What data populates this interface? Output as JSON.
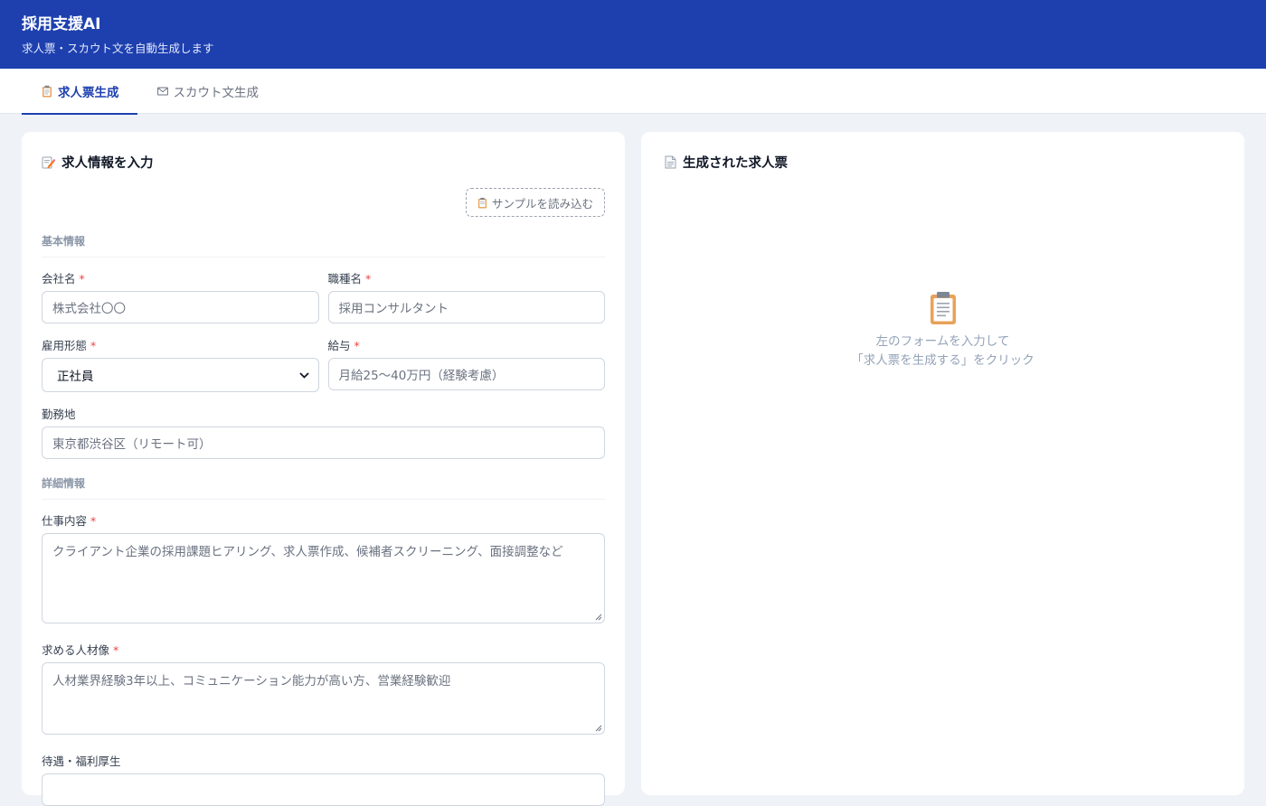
{
  "app": {
    "title": "採用支援AI",
    "subtitle": "求人票・スカウト文を自動生成します"
  },
  "tabs": [
    {
      "label": "求人票生成",
      "icon": "clipboard-icon",
      "active": true
    },
    {
      "label": "スカウト文生成",
      "icon": "envelope-icon",
      "active": false
    }
  ],
  "form": {
    "title": "求人情報を入力",
    "sample_button": "サンプルを読み込む",
    "required_mark": "*",
    "sections": {
      "basic": "基本情報",
      "detail": "詳細情報"
    },
    "company": {
      "label": "会社名",
      "placeholder": "株式会社〇〇"
    },
    "job_title": {
      "label": "職種名",
      "placeholder": "採用コンサルタント"
    },
    "employment_type": {
      "label": "雇用形態",
      "value": "正社員"
    },
    "salary": {
      "label": "給与",
      "placeholder": "月給25〜40万円（経験考慮）"
    },
    "location": {
      "label": "勤務地",
      "placeholder": "東京都渋谷区（リモート可）"
    },
    "job_description": {
      "label": "仕事内容",
      "placeholder": "クライアント企業の採用課題ヒアリング、求人票作成、候補者スクリーニング、面接調整など"
    },
    "ideal_candidate": {
      "label": "求める人材像",
      "placeholder": "人材業界経験3年以上、コミュニケーション能力が高い方、営業経験歓迎"
    },
    "benefits": {
      "label": "待遇・福利厚生"
    }
  },
  "result": {
    "title": "生成された求人票",
    "empty_line1": "左のフォームを入力して",
    "empty_line2": "「求人票を生成する」をクリック"
  },
  "colors": {
    "header": "#1e40af",
    "required": "#ef4444",
    "background": "#eff3f8"
  }
}
